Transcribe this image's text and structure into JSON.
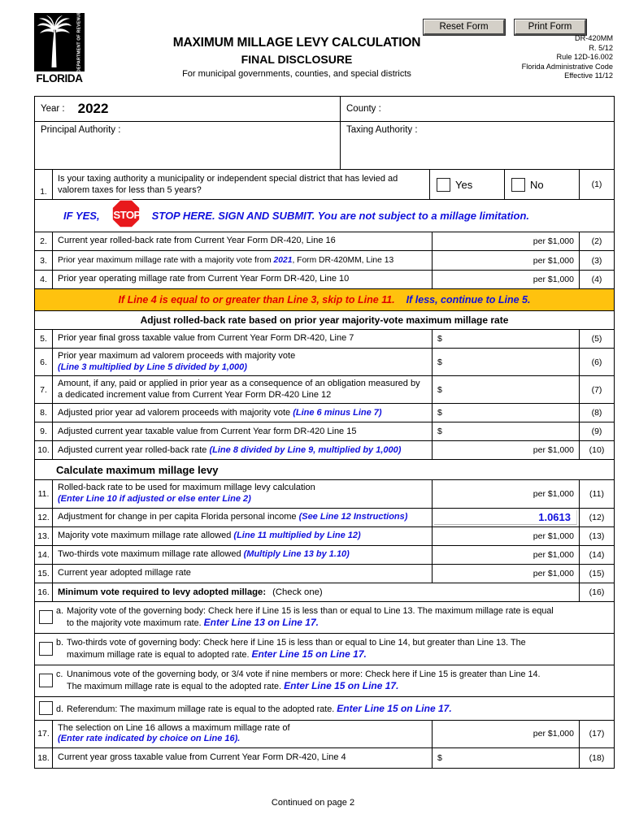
{
  "header": {
    "logo": {
      "state": "FLORIDA",
      "dept": "DEPARTMENT OF REVENUE"
    },
    "title_line1": "MAXIMUM MILLAGE LEVY CALCULATION",
    "title_line2": "FINAL DISCLOSURE",
    "subtitle": "For municipal governments, counties, and special districts",
    "reset_button": "Reset Form",
    "print_button": "Print Form",
    "meta": [
      "DR-420MM",
      "R. 5/12",
      "Rule 12D-16.002",
      "Florida Administrative Code",
      "Effective 11/12"
    ]
  },
  "identity": {
    "year_label": "Year :",
    "year_value": "2022",
    "county_label": "County :",
    "county_value": "",
    "principal_label": "Principal Authority :",
    "principal_value": "",
    "taxing_label": "Taxing Authority :",
    "taxing_value": ""
  },
  "question1": {
    "number": "1.",
    "text": "Is your taxing authority a municipality or independent special district that has levied ad valorem taxes for less than 5 years?",
    "yes_label": "Yes",
    "no_label": "No",
    "tag": "(1)"
  },
  "stop_banner": {
    "if_yes": "IF YES,",
    "stop_sign_text": "STOP",
    "message": "STOP HERE.  SIGN AND SUBMIT. You are not subject to a millage limitation."
  },
  "yellow_banner": {
    "red_text": "If Line 4 is equal to or greater than Line 3, skip to Line 11.",
    "blue_text": "If less, continue to Line 5."
  },
  "section_headers": {
    "adjust": "Adjust rolled-back rate based on prior year majority-vote maximum millage rate",
    "calculate": "Calculate maximum millage levy"
  },
  "per_unit": "per $1,000",
  "dollar_sign": "$",
  "lines": [
    {
      "number": "2.",
      "text": "Current year rolled-back rate from Current Year Form DR-420, Line 16",
      "note": "",
      "value_type": "rate",
      "value": "",
      "tag": "(2)"
    },
    {
      "number": "3.",
      "text_a": "Prior year maximum millage rate with a majority vote from ",
      "text_year": "2021",
      "text_b": ", Form DR-420MM, Line 13",
      "value_type": "rate",
      "value": "",
      "tag": "(3)"
    },
    {
      "number": "4.",
      "text": "Prior year operating millage rate from Current Year Form DR-420, Line 10",
      "note": "",
      "value_type": "rate",
      "value": "",
      "tag": "(4)"
    },
    {
      "number": "5.",
      "text": "Prior year final gross taxable value from Current Year Form DR-420, Line 7",
      "note": "",
      "value_type": "dollar",
      "value": "",
      "tag": "(5)"
    },
    {
      "number": "6.",
      "text": "Prior year maximum ad valorem proceeds with majority vote",
      "note": "(Line 3 multiplied by Line 5 divided by 1,000)",
      "value_type": "dollar",
      "value": "",
      "tag": "(6)"
    },
    {
      "number": "7.",
      "text": "Amount, if any, paid or applied in prior year as a consequence of an obligation measured by a dedicated increment value from Current Year  Form DR-420 Line 12",
      "note": "",
      "value_type": "dollar",
      "value": "",
      "tag": "(7)"
    },
    {
      "number": "8.",
      "text": "Adjusted prior year ad valorem proceeds with majority vote  ",
      "note_inline": "(Line 6 minus Line 7)",
      "value_type": "dollar",
      "value": "",
      "tag": "(8)"
    },
    {
      "number": "9.",
      "text": "Adjusted current year taxable value  from Current Year form DR-420 Line 15",
      "note": "",
      "value_type": "dollar",
      "value": "",
      "tag": "(9)"
    },
    {
      "number": "10.",
      "text": "Adjusted current year rolled-back rate ",
      "note_inline": "(Line 8 divided by Line 9, multiplied by 1,000)",
      "value_type": "rate",
      "value": "",
      "tag": "(10)"
    },
    {
      "number": "11.",
      "text": "Rolled-back rate to be used for maximum millage levy calculation",
      "note": "(Enter Line 10 if adjusted or else enter Line 2)",
      "value_type": "rate",
      "value": "",
      "tag": "(11)"
    },
    {
      "number": "12.",
      "text": "Adjustment for change in per capita Florida personal income ",
      "note_inline": "(See Line 12  Instructions)",
      "value_type": "field",
      "value": "1.0613",
      "tag": "(12)"
    },
    {
      "number": "13.",
      "text": "Majority vote maximum millage rate allowed ",
      "note_inline": "(Line 11 multiplied by Line 12)",
      "value_type": "rate",
      "value": "",
      "tag": "(13)"
    },
    {
      "number": "14.",
      "text": "Two-thirds vote maximum millage rate allowed ",
      "note_inline": "(Multiply Line 13 by 1.10)",
      "value_type": "rate",
      "value": "",
      "tag": "(14)"
    },
    {
      "number": "15.",
      "text": "Current year adopted millage rate",
      "note": "",
      "value_type": "rate",
      "value": "",
      "tag": "(15)"
    }
  ],
  "line16": {
    "number": "16.",
    "bold_text": "Minimum vote required to levy adopted millage:",
    "plain_text": "(Check one)",
    "tag": "(16)"
  },
  "vote_options": [
    {
      "letter": "a.",
      "line1": "Majority vote of the governing body:  Check here if Line 15  is less than or equal to Line 13. The maximum millage rate is equal",
      "line2_plain": "to the majority vote maximum rate. ",
      "line2_blue": "Enter Line 13 on Line 17."
    },
    {
      "letter": "b.",
      "line1": "Two-thirds vote of governing body:  Check here if Line 15 is less than or equal to Line 14, but greater than Line 13. The",
      "line2_plain": "maximum millage rate is equal to adopted rate. ",
      "line2_blue": "Enter Line 15 on Line 17."
    },
    {
      "letter": "c.",
      "line1": "Unanimous vote of the governing body, or 3/4 vote if nine members or more:  Check here if Line 15 is greater than Line 14.",
      "line2_plain": "The maximum millage rate is equal to the adopted rate. ",
      "line2_blue": "Enter Line 15 on Line 17."
    },
    {
      "letter": "d.",
      "line1": "",
      "line2_plain": "Referendum:  The maximum millage rate is equal to the adopted rate. ",
      "line2_blue": "Enter Line 15 on Line 17."
    }
  ],
  "line17": {
    "number": "17.",
    "text": "The selection on Line 16 allows a maximum millage rate of",
    "note": "(Enter rate indicated by choice on Line 16).",
    "value": "",
    "tag": "(17)"
  },
  "line18": {
    "number": "18.",
    "text": "Current year gross taxable value from Current Year Form DR-420, Line 4",
    "value": "",
    "tag": "(18)"
  },
  "footer": "Continued on page 2",
  "colors": {
    "blue": "#1111dd",
    "red": "#e00000",
    "yellow": "#FFC20E",
    "stop_red": "#e8191c"
  }
}
